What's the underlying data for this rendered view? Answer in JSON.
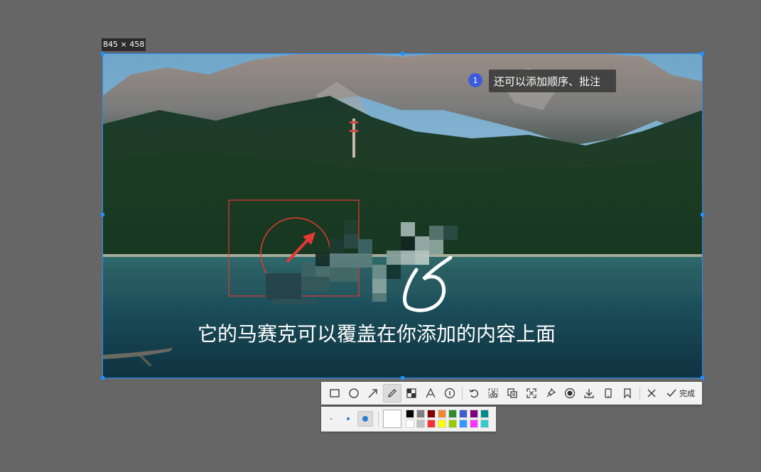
{
  "capture": {
    "size_label": "845 × 458"
  },
  "annotations": {
    "step_number": "1",
    "step_note": "还可以添加顺序、批注",
    "caption_text": "它的马赛克可以覆盖在你添加的内容上面"
  },
  "toolbar": {
    "tools": [
      {
        "name": "rectangle-tool",
        "icon": "rectangle-icon",
        "active": false
      },
      {
        "name": "ellipse-tool",
        "icon": "ellipse-icon",
        "active": false
      },
      {
        "name": "arrow-tool",
        "icon": "arrow-icon",
        "active": false
      },
      {
        "name": "pen-tool",
        "icon": "pencil-icon",
        "active": true
      },
      {
        "name": "mosaic-tool",
        "icon": "mosaic-icon",
        "active": false
      },
      {
        "name": "text-tool",
        "icon": "text-icon",
        "active": false
      },
      {
        "name": "serial-number-tool",
        "icon": "numbered-circle-icon",
        "active": false
      }
    ],
    "actions": [
      {
        "name": "undo-button",
        "icon": "undo-icon"
      },
      {
        "name": "cut-button",
        "icon": "scissors-icon"
      },
      {
        "name": "ocr-button",
        "icon": "ocr-icon"
      },
      {
        "name": "fullscreen-button",
        "icon": "expand-icon"
      },
      {
        "name": "pin-button",
        "icon": "pin-icon"
      },
      {
        "name": "record-button",
        "icon": "record-icon"
      },
      {
        "name": "download-button",
        "icon": "download-icon"
      },
      {
        "name": "phone-button",
        "icon": "phone-icon"
      },
      {
        "name": "bookmark-button",
        "icon": "bookmark-icon"
      }
    ],
    "close_icon": "close-icon",
    "done_label": "完成"
  },
  "style_bar": {
    "brush_sizes": [
      "small",
      "medium",
      "large"
    ],
    "selected_brush": "large",
    "current_color": "#ffffff",
    "palette": [
      "#000000",
      "#808080",
      "#800000",
      "#f0883a",
      "#2e8b2e",
      "#3a5fcd",
      "#800080",
      "#008b8b",
      "#ffffff",
      "#c0c0c0",
      "#ff3030",
      "#ffff00",
      "#99cc00",
      "#3399ff",
      "#ff33ff",
      "#33cccc"
    ]
  },
  "colors": {
    "selection_border": "#1e90ff",
    "annotation_red": "#e53935",
    "step_badge": "#3b5bdb"
  }
}
